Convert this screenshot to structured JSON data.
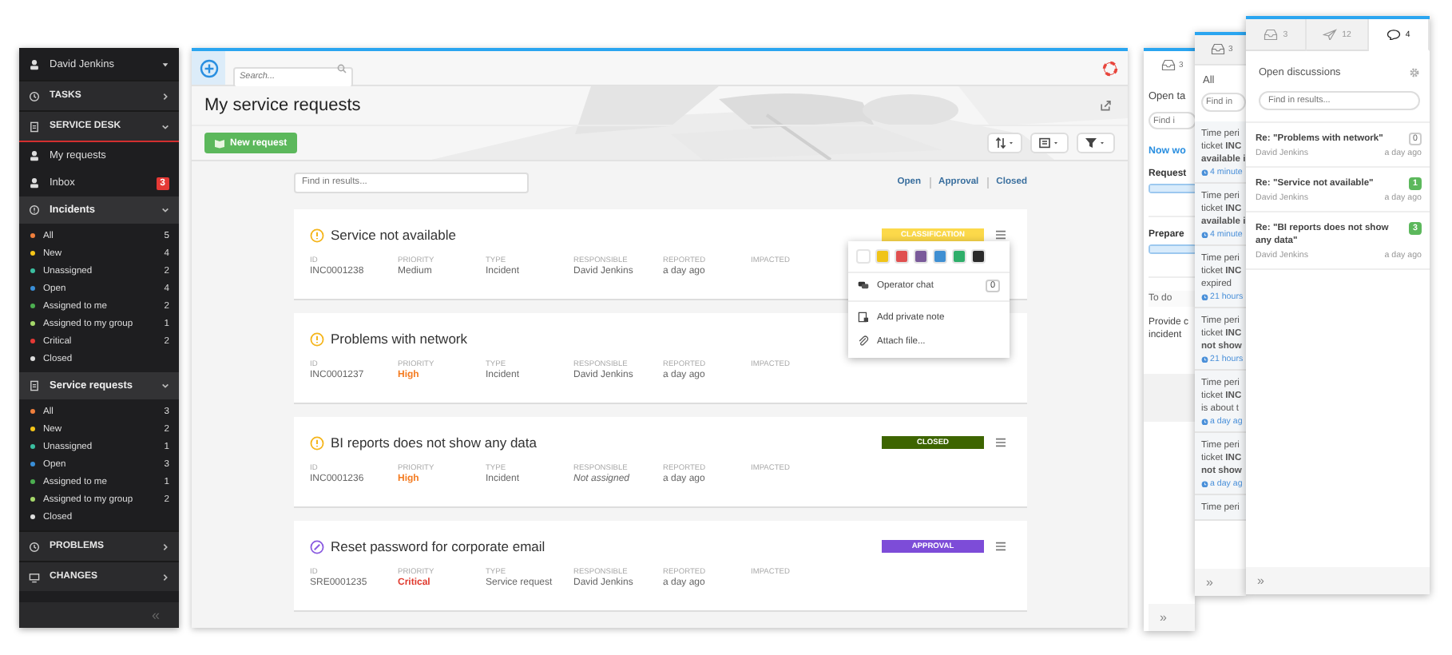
{
  "sidebar": {
    "user": "David Jenkins",
    "items": [
      {
        "kind": "section",
        "label": "TASKS",
        "expanded": false,
        "selected": false
      },
      {
        "kind": "section",
        "label": "SERVICE DESK",
        "expanded": true,
        "selected": true
      },
      {
        "kind": "link",
        "label": "My requests"
      },
      {
        "kind": "link",
        "label": "Inbox",
        "badge": "3"
      },
      {
        "kind": "group",
        "label": "Incidents",
        "expanded": true,
        "children": [
          {
            "label": "All",
            "count": "5",
            "color": "#f07f3c"
          },
          {
            "label": "New",
            "count": "4",
            "color": "#f5c518"
          },
          {
            "label": "Unassigned",
            "count": "2",
            "color": "#3bbfa0"
          },
          {
            "label": "Open",
            "count": "4",
            "color": "#3a8fd8"
          },
          {
            "label": "Assigned to me",
            "count": "2",
            "color": "#4caf50"
          },
          {
            "label": "Assigned to my group",
            "count": "1",
            "color": "#a5d86a"
          },
          {
            "label": "Critical",
            "count": "2",
            "color": "#e53935"
          },
          {
            "label": "Closed",
            "color": "#dddddd"
          }
        ]
      },
      {
        "kind": "group",
        "label": "Service requests",
        "expanded": true,
        "children": [
          {
            "label": "All",
            "count": "3",
            "color": "#f07f3c"
          },
          {
            "label": "New",
            "count": "2",
            "color": "#f5c518"
          },
          {
            "label": "Unassigned",
            "count": "1",
            "color": "#3bbfa0"
          },
          {
            "label": "Open",
            "count": "3",
            "color": "#3a8fd8"
          },
          {
            "label": "Assigned to me",
            "count": "1",
            "color": "#4caf50"
          },
          {
            "label": "Assigned to my group",
            "count": "2",
            "color": "#a5d86a"
          },
          {
            "label": "Closed",
            "color": "#dddddd"
          }
        ]
      },
      {
        "kind": "section",
        "label": "PROBLEMS",
        "expanded": false,
        "selected": false
      },
      {
        "kind": "section",
        "label": "CHANGES",
        "expanded": false,
        "selected": false
      }
    ],
    "collapse": "«"
  },
  "main": {
    "search_placeholder": "Search...",
    "title": "My service requests",
    "new_button": "New request",
    "find_placeholder": "Find in results...",
    "filters": [
      {
        "label": "Open"
      },
      {
        "label": "Approval"
      },
      {
        "label": "Closed"
      }
    ],
    "tickets": [
      {
        "kind": "incident",
        "title": "Service not available",
        "assigned": true,
        "badge": {
          "label": "CLASSIFICATION",
          "color": "#fcd94a"
        },
        "fields": [
          {
            "label": "ID",
            "value": "INC0001238"
          },
          {
            "label": "PRIORITY",
            "value": "Medium",
            "color": "#666666"
          },
          {
            "label": "TYPE",
            "value": "Incident"
          },
          {
            "label": "RESPONSIBLE",
            "value": "David Jenkins"
          },
          {
            "label": "REPORTED",
            "value": "a day ago"
          },
          {
            "label": "IMPACTED"
          }
        ]
      },
      {
        "kind": "incident",
        "title": "Problems with network",
        "assigned": true,
        "fields": [
          {
            "label": "ID",
            "value": "INC0001237"
          },
          {
            "label": "PRIORITY",
            "value": "High",
            "color": "#f47b20"
          },
          {
            "label": "TYPE",
            "value": "Incident"
          },
          {
            "label": "RESPONSIBLE",
            "value": "David Jenkins"
          },
          {
            "label": "REPORTED",
            "value": "a day ago"
          },
          {
            "label": "IMPACTED"
          }
        ]
      },
      {
        "kind": "incident",
        "title": "BI reports does not show any data",
        "assigned": false,
        "badge": {
          "label": "CLOSED",
          "color": "#3d6500"
        },
        "fields": [
          {
            "label": "ID",
            "value": "INC0001236"
          },
          {
            "label": "PRIORITY",
            "value": "High",
            "color": "#f47b20"
          },
          {
            "label": "TYPE",
            "value": "Incident"
          },
          {
            "label": "RESPONSIBLE",
            "value": "Not assigned"
          },
          {
            "label": "REPORTED",
            "value": "a day ago"
          },
          {
            "label": "IMPACTED"
          }
        ]
      },
      {
        "kind": "request",
        "title": "Reset password for corporate email",
        "assigned": true,
        "badge": {
          "label": "APPROVAL",
          "color": "#7d4cd8"
        },
        "fields": [
          {
            "label": "ID",
            "value": "SRE0001235"
          },
          {
            "label": "PRIORITY",
            "value": "Critical",
            "color": "#e03a2e"
          },
          {
            "label": "TYPE",
            "value": "Service request"
          },
          {
            "label": "RESPONSIBLE",
            "value": "David Jenkins"
          },
          {
            "label": "REPORTED",
            "value": "a day ago"
          },
          {
            "label": "IMPACTED"
          }
        ]
      }
    ],
    "menu": {
      "colors": [
        {
          "color": "#ffffff"
        },
        {
          "color": "#f0c419"
        },
        {
          "color": "#e05050"
        },
        {
          "color": "#7a5a9a"
        },
        {
          "color": "#3f8fd2"
        },
        {
          "color": "#2fae6a"
        },
        {
          "color": "#2b2b2b"
        }
      ],
      "items": [
        {
          "kind": "chat",
          "label": "Operator chat",
          "count": "0"
        },
        {
          "kind": "note",
          "label": "Add private note"
        },
        {
          "kind": "attach",
          "label": "Attach file..."
        }
      ]
    }
  },
  "tasks_panel": {
    "tab_count": "3",
    "header": "Open ta",
    "find_placeholder": "Find i",
    "link": "Now wo",
    "tasks": [
      {
        "label": "Request",
        "level": 1
      },
      {
        "label": "Prepare",
        "level": 1
      }
    ],
    "todo_header": "To do",
    "todo_text": "Provide c\nincident",
    "footer": "»"
  },
  "notifications_panel": {
    "tab_count": "3",
    "filter": "All",
    "find_placeholder": "Find in",
    "items": [
      {
        "text": "Time peri\nticket **INC**\n**available i**",
        "time": "4 minute"
      },
      {
        "text": "Time peri\nticket **INC**\n**available i**",
        "time": "4 minute"
      },
      {
        "text": "Time peri\nticket **INC**\nexpired",
        "time": "21 hours"
      },
      {
        "text": "Time peri\nticket **INC**\n**not show**",
        "time": "21 hours"
      },
      {
        "text": "Time peri\nticket **INC**\nis about t",
        "time": "a day ag"
      },
      {
        "text": "Time peri\nticket **INC**\n**not show**",
        "time": "a day ag"
      },
      {
        "text": "Time peri"
      }
    ],
    "footer": "»"
  },
  "discussions_panel": {
    "tabs": [
      {
        "count": "3",
        "selected": false
      },
      {
        "count": "12",
        "selected": false
      },
      {
        "count": "4",
        "selected": true
      }
    ],
    "header": "Open discussions",
    "find_placeholder": "Find in results...",
    "items": [
      {
        "title": "Re: \"Problems with network\"",
        "author": "David Jenkins",
        "time": "a day ago",
        "count": "0",
        "unread": false
      },
      {
        "title": "Re: \"Service not available\"",
        "author": "David Jenkins",
        "time": "a day ago",
        "count": "1",
        "unread": true
      },
      {
        "title": "Re: \"BI reports does not show any data\"",
        "author": "David Jenkins",
        "time": "a day ago",
        "count": "3",
        "unread": true
      }
    ],
    "footer": "»"
  }
}
